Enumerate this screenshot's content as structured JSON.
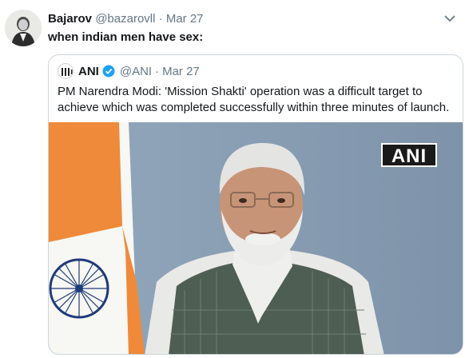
{
  "tweet": {
    "display_name": "Bajarov",
    "handle": "@bazarovll",
    "separator": "·",
    "date": "Mar 27",
    "text": "when indian men have sex:",
    "menu_icon": "chevron-down-icon",
    "avatar_icon": "portrait-avatar"
  },
  "quote": {
    "display_name": "ANI",
    "verified_icon": "verified-badge-icon",
    "handle": "@ANI",
    "separator": "·",
    "date": "Mar 27",
    "text": "PM Narendra Modi: 'Mission Shakti' operation was a difficult target to achieve which was completed successfully within three minutes of launch.",
    "media": {
      "watermark": "ANI"
    }
  },
  "colors": {
    "text_primary": "#14171a",
    "text_secondary": "#657786",
    "border": "#ccd6dd",
    "verified": "#1da1f2"
  }
}
